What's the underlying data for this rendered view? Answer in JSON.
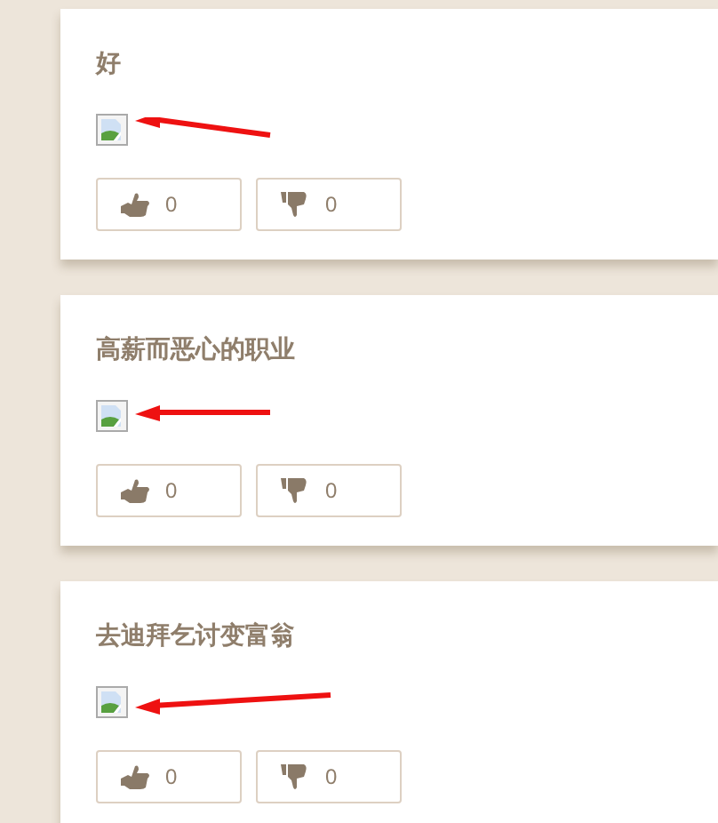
{
  "posts": [
    {
      "title": "好",
      "likes": "0",
      "dislikes": "0"
    },
    {
      "title": "高薪而恶心的职业",
      "likes": "0",
      "dislikes": "0"
    },
    {
      "title": "去迪拜乞讨变富翁",
      "likes": "0",
      "dislikes": "0"
    }
  ]
}
